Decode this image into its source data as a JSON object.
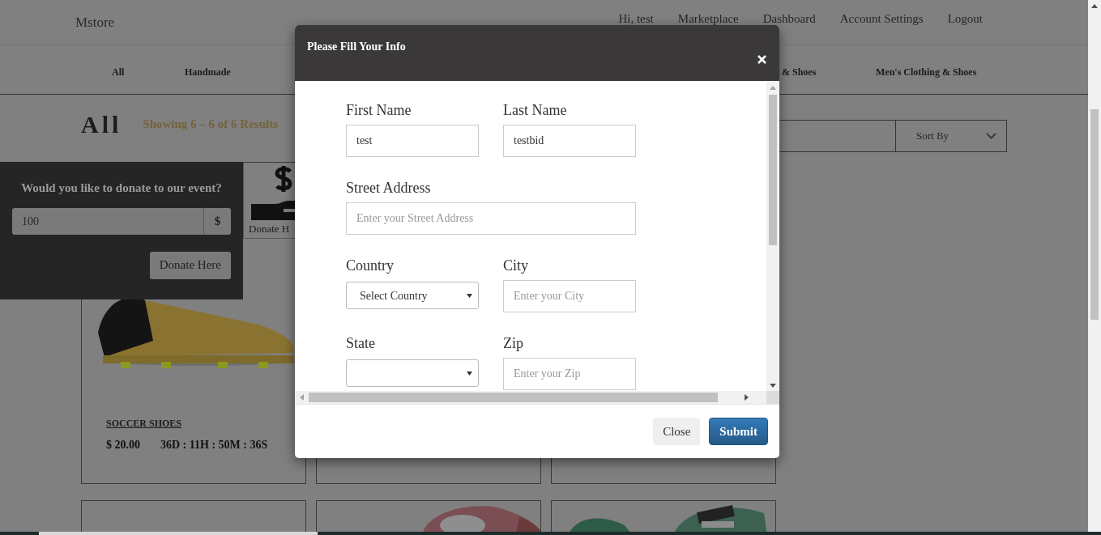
{
  "header": {
    "brand": "Mstore",
    "nav": [
      "Hi, test",
      "Marketplace",
      "Dashboard",
      "Account Settings",
      "Logout"
    ]
  },
  "categories": [
    "All",
    "Handmade",
    "& Shoes",
    "Men's Clothing & Shoes"
  ],
  "listing": {
    "title": "All",
    "results": "Showing 6 – 6 of 6 Results",
    "sort": "Sort By"
  },
  "donate_card": {
    "label": "Donate H"
  },
  "donate_popup": {
    "question": "Would you like to donate to our event?",
    "amount": "100",
    "currency": "$",
    "button": "Donate Here"
  },
  "products": [
    {
      "kind": "item",
      "name": "SOCCER SHOES",
      "price": "$ 20.00",
      "countdown": "36D : 11H : 50M : 36S"
    },
    {
      "kind": "blank"
    },
    {
      "kind": "blank"
    },
    {
      "kind": "blank"
    },
    {
      "kind": "picture"
    },
    {
      "kind": "picture"
    }
  ],
  "modal": {
    "title": "Please Fill Your Info",
    "rows": [
      [
        {
          "kind": "text",
          "label": "First Name",
          "value": "test"
        },
        {
          "kind": "text",
          "label": "Last Name",
          "value": "testbid"
        }
      ],
      [
        {
          "kind": "text",
          "label": "Street Address",
          "placeholder": "Enter your Street Address"
        }
      ],
      [
        {
          "kind": "select",
          "label": "Country",
          "value": "Select Country"
        },
        {
          "kind": "text",
          "label": "City",
          "placeholder": "Enter your City"
        }
      ],
      [
        {
          "kind": "select",
          "label": "State"
        },
        {
          "kind": "text",
          "label": "Zip",
          "placeholder": "Enter your Zip"
        }
      ]
    ],
    "buttons": [
      {
        "kind": "secondary",
        "label": "Close"
      },
      {
        "kind": "primary",
        "label": "Submit"
      }
    ]
  }
}
